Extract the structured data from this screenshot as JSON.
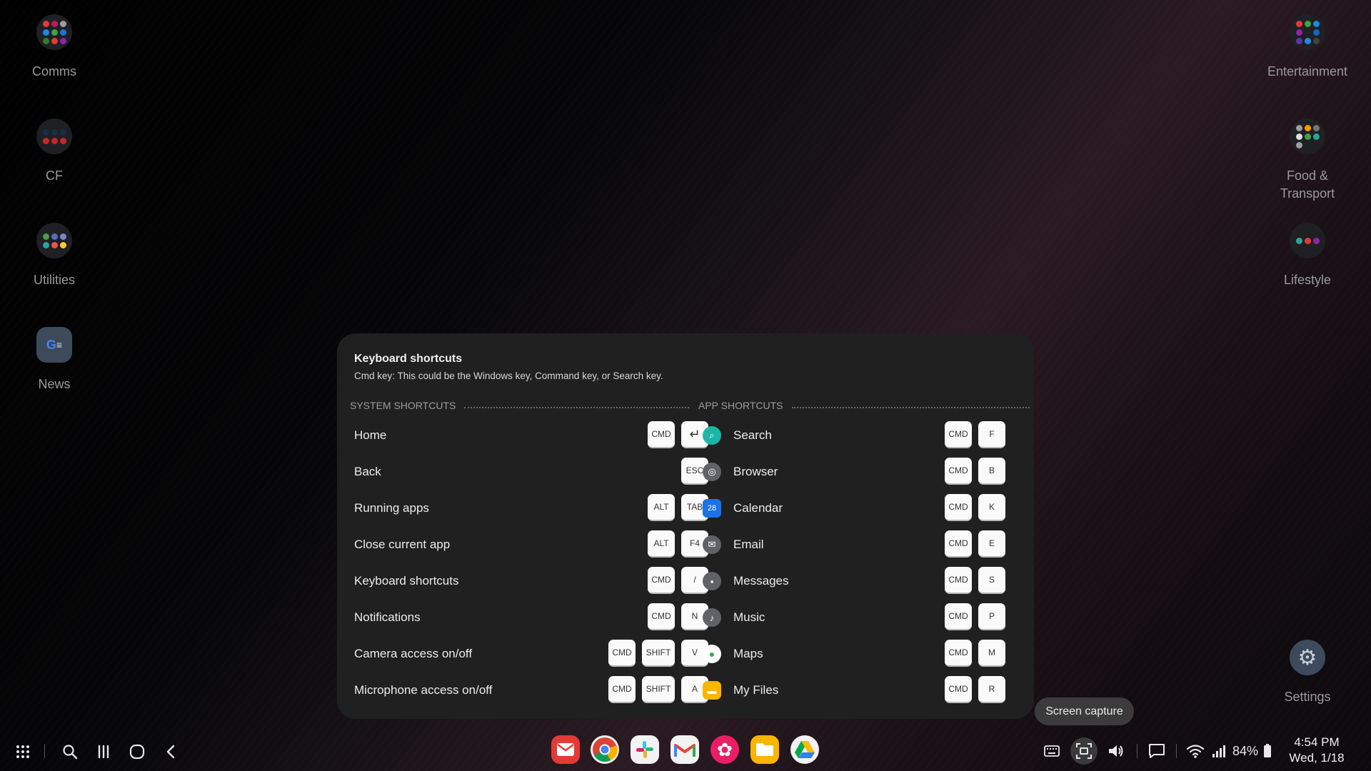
{
  "desktop": {
    "left_icons": [
      {
        "label": "Comms"
      },
      {
        "label": "CF"
      },
      {
        "label": "Utilities"
      },
      {
        "label": "News"
      }
    ],
    "right_icons": [
      {
        "label": "Entertainment"
      },
      {
        "label": "Food &"
      },
      {
        "label": "Transport"
      },
      {
        "label": "Lifestyle"
      },
      {
        "label": "Settings"
      }
    ]
  },
  "shortcuts_panel": {
    "title": "Keyboard shortcuts",
    "subtitle": "Cmd key: This could be the Windows key, Command key, or Search key.",
    "system_header": "SYSTEM SHORTCUTS",
    "app_header": "APP SHORTCUTS",
    "system": [
      {
        "name": "Home",
        "keys": [
          "CMD",
          "↵"
        ]
      },
      {
        "name": "Back",
        "keys": [
          "ESC"
        ]
      },
      {
        "name": "Running apps",
        "keys": [
          "ALT",
          "TAB"
        ]
      },
      {
        "name": "Close current app",
        "keys": [
          "ALT",
          "F4"
        ]
      },
      {
        "name": "Keyboard shortcuts",
        "keys": [
          "CMD",
          "/"
        ]
      },
      {
        "name": "Notifications",
        "keys": [
          "CMD",
          "N"
        ]
      },
      {
        "name": "Camera access on/off",
        "keys": [
          "CMD",
          "SHIFT",
          "V"
        ]
      },
      {
        "name": "Microphone access on/off",
        "keys": [
          "CMD",
          "SHIFT",
          "A"
        ]
      }
    ],
    "apps": [
      {
        "name": "Search",
        "icon": "search-app-icon",
        "color": "#1bb6a6",
        "glyph": "⌕",
        "keys": [
          "CMD",
          "F"
        ]
      },
      {
        "name": "Browser",
        "icon": "globe-icon",
        "color": "#5f6368",
        "glyph": "◎",
        "keys": [
          "CMD",
          "B"
        ]
      },
      {
        "name": "Calendar",
        "icon": "calendar-icon",
        "color": "#1a73e8",
        "glyph": "28",
        "keys": [
          "CMD",
          "K"
        ]
      },
      {
        "name": "Email",
        "icon": "mail-icon",
        "color": "#5f6368",
        "glyph": "✉",
        "keys": [
          "CMD",
          "E"
        ]
      },
      {
        "name": "Messages",
        "icon": "message-icon",
        "color": "#5f6368",
        "glyph": "▪",
        "keys": [
          "CMD",
          "S"
        ]
      },
      {
        "name": "Music",
        "icon": "music-icon",
        "color": "#5f6368",
        "glyph": "♪",
        "keys": [
          "CMD",
          "P"
        ]
      },
      {
        "name": "Maps",
        "icon": "maps-pin-icon",
        "color": "#ffffff",
        "glyph": "●",
        "keys": [
          "CMD",
          "M"
        ]
      },
      {
        "name": "My Files",
        "icon": "folder-icon",
        "color": "#f9b500",
        "glyph": "▬",
        "keys": [
          "CMD",
          "R"
        ]
      }
    ]
  },
  "tooltip": {
    "text": "Screen capture"
  },
  "taskbar": {
    "dock_apps": [
      {
        "name": "email-app-icon",
        "color": "#e53935"
      },
      {
        "name": "chrome-icon",
        "color": "#e8e8e8"
      },
      {
        "name": "slack-icon",
        "color": "#e8e8e8"
      },
      {
        "name": "gmail-icon",
        "color": "#f1f1f1"
      },
      {
        "name": "gallery-flower-icon",
        "color": "#e91e63"
      },
      {
        "name": "my-files-icon",
        "color": "#f9b500"
      },
      {
        "name": "drive-icon",
        "color": "#f1f1f1"
      }
    ],
    "battery": "84%",
    "time": "4:54 PM",
    "date": "Wed, 1/18"
  }
}
